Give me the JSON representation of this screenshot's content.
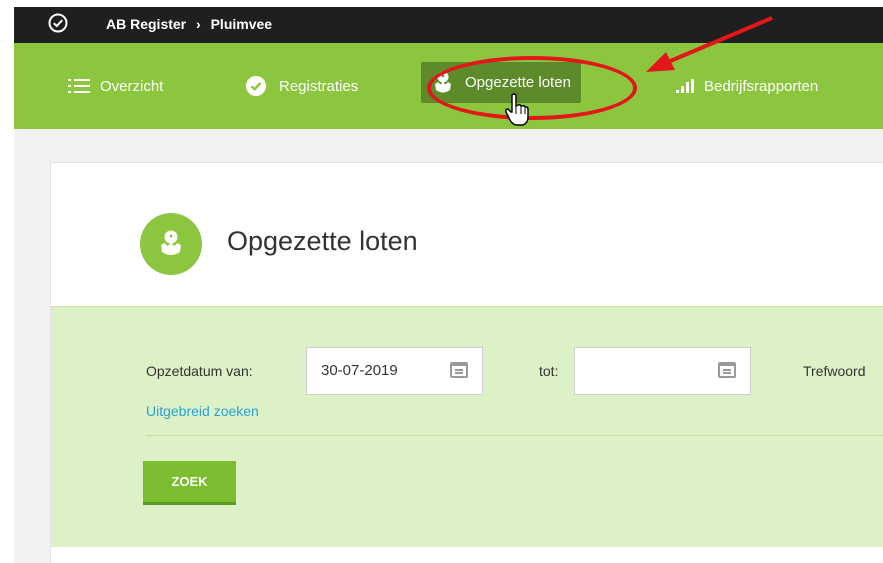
{
  "topbar": {
    "app": "AB Register",
    "separator": "›",
    "section": "Pluimvee"
  },
  "nav": {
    "items": [
      {
        "label": "Overzicht",
        "icon": "list-icon",
        "active": false
      },
      {
        "label": "Registraties",
        "icon": "check-circle-icon",
        "active": false
      },
      {
        "label": "Opgezette loten",
        "icon": "chick-icon",
        "active": true
      },
      {
        "label": "Bedrijfsrapporten",
        "icon": "bar-chart-icon",
        "active": false
      }
    ]
  },
  "page": {
    "title": "Opgezette loten",
    "title_icon": "chick-icon"
  },
  "filter": {
    "from_label": "Opzetdatum van:",
    "from_value": "30-07-2019",
    "to_label": "tot:",
    "to_value": "",
    "keyword_label": "Trefwoord",
    "advanced_link": "Uitgebreid zoeken",
    "search_button": "ZOEK"
  },
  "colors": {
    "topbar": "#1f1f1f",
    "nav_green": "#8cc63e",
    "nav_active": "#5d8b2a",
    "filter_bg": "#dcf2c6",
    "button": "#7bbd2f",
    "link": "#2aa0d8",
    "annotation_red": "#e3161a"
  }
}
